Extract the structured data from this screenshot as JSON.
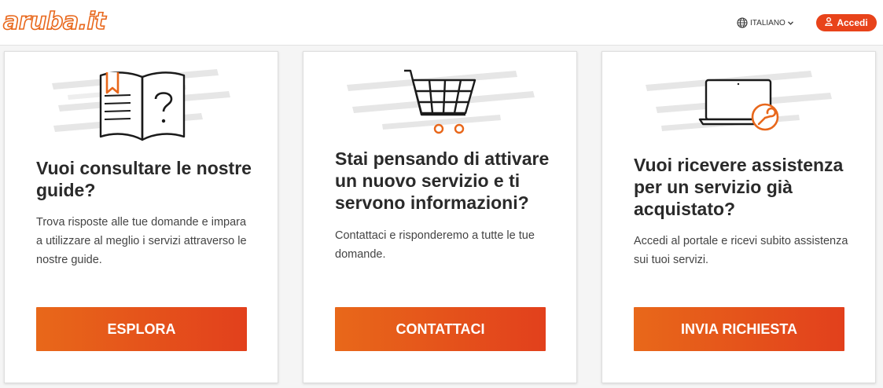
{
  "header": {
    "logo_text": "aruba.it",
    "language_label": "ITALIANO",
    "login_label": "Accedi"
  },
  "cards": [
    {
      "icon": "guide-book-icon",
      "title": "Vuoi consultare le nostre guide?",
      "text": "Trova risposte alle tue domande e impara a utilizzare al meglio i servizi attraverso le nostre guide.",
      "button": "ESPLORA"
    },
    {
      "icon": "shopping-cart-icon",
      "title": "Stai pensando di attivare un nuovo servizio e ti servono informazioni?",
      "text": "Contattaci e risponderemo a tutte le tue domande.",
      "button": "CONTATTACI"
    },
    {
      "icon": "laptop-support-icon",
      "title": "Vuoi ricevere assistenza per un servizio già acquistato?",
      "text": "Accedi al portale e ricevi subito assistenza sui tuoi servizi.",
      "button": "INVIA RICHIESTA"
    }
  ],
  "colors": {
    "brand_orange": "#e8671b",
    "button_start": "#e8681a",
    "button_end": "#e2401c",
    "login_red": "#e8431a"
  }
}
